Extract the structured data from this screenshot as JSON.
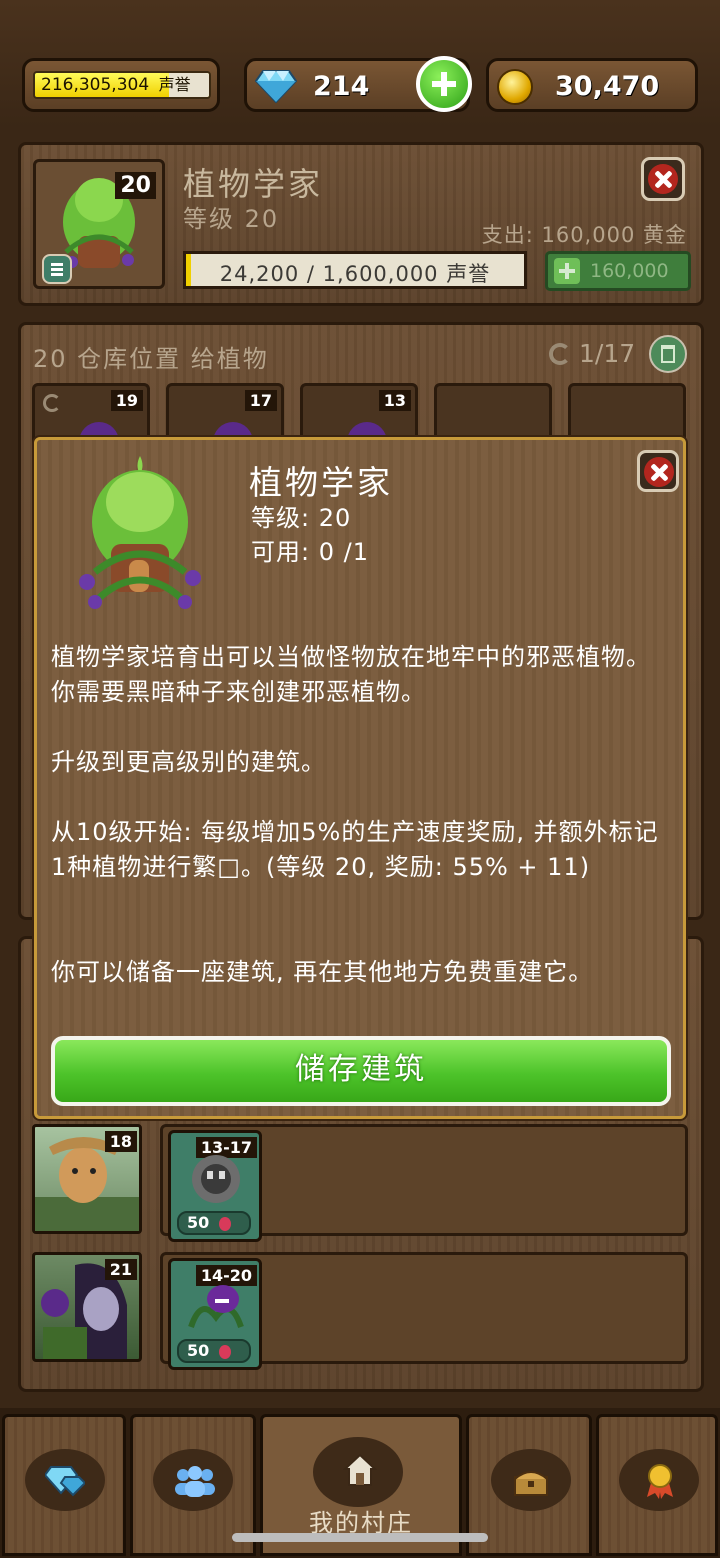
{
  "topbar": {
    "fame_value": "216,305,304",
    "fame_unit": "声誉",
    "gems": "214",
    "gold": "30,470",
    "icons": [
      "diamond-icon",
      "plus-icon",
      "gold-coin-icon"
    ]
  },
  "building": {
    "name": "植物学家",
    "level_label": "等级 20",
    "level_badge": "20",
    "expense": "支出: 160,000 黄金",
    "progress_text": "24,200 / 1,600,000 声誉",
    "progress_fraction": 0.0151,
    "upgrade_price": "160,000"
  },
  "storage": {
    "title": "20 仓库位置 给植物",
    "count": "1/17",
    "slots": [
      {
        "badge": "19"
      },
      {
        "badge": "17"
      },
      {
        "badge": "13"
      },
      {
        "badge": ""
      },
      {
        "badge": ""
      }
    ]
  },
  "modal": {
    "title": "植物学家",
    "level": "等级: 20",
    "available": "可用: 0 /1",
    "p1": "植物学家培育出可以当做怪物放在地牢中的邪恶植物。你需要黑暗种子来创建邪恶植物。",
    "p2": "升级到更高级别的建筑。",
    "p3": "从10级开始: 每级增加5%的生产速度奖励, 并额外标记1种植物进行繁□。(等级  20, 奖励: 55% + 11)",
    "p4": "你可以储备一座建筑, 再在其他地方免费重建它。",
    "store_button": "储存建筑"
  },
  "workers": [
    {
      "level": "18",
      "plant_range": "13-17",
      "price": "50"
    },
    {
      "level": "21",
      "plant_range": "14-20",
      "price": "50"
    }
  ],
  "nav": {
    "home_label": "我的村庄",
    "icons": [
      "gems-nav-icon",
      "people-nav-icon",
      "home-nav-icon",
      "chest-nav-icon",
      "medal-nav-icon"
    ]
  },
  "colors": {
    "accent_green": "#4dc32a",
    "fame_yellow": "#f0d000",
    "close_red": "#b3261e",
    "modal_border": "#c79a3a"
  }
}
